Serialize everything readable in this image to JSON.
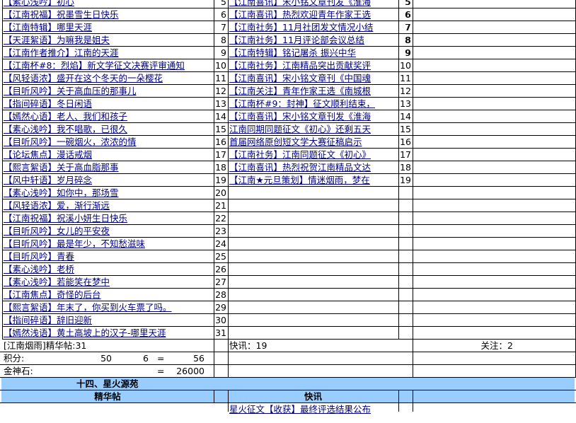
{
  "left_posts": [
    {
      "text": "【素心浅吟】初心",
      "n": "5"
    },
    {
      "text": "【江南祝福】祝墨雪生日快乐",
      "n": "6"
    },
    {
      "text": "【江南特辑】哪里天涯",
      "n": "7"
    },
    {
      "text": "【天涯絮语】为嘛我是姐夫",
      "n": "8"
    },
    {
      "text": "【江南作者推介】江南的天涯",
      "n": "9"
    },
    {
      "text": "【江南杯#8：烈焰】新文学征文决赛评审通知",
      "n": "10"
    },
    {
      "text": "【风轻语浓】盛开在这个冬天的一朵樱花",
      "n": "11"
    },
    {
      "text": "【目听风吟】关于高血压的那事儿",
      "n": "12"
    },
    {
      "text": "【指间碎语】冬日闲语",
      "n": "13"
    },
    {
      "text": "【嫣然心语】老人、我们和孩子",
      "n": "14"
    },
    {
      "text": "【素心浅吟】我不唱歌，已很久",
      "n": "15"
    },
    {
      "text": "【目听风吟】一碗烟火，浓浓的情",
      "n": "16"
    },
    {
      "text": "【论坛焦点】漫话戒烟",
      "n": "17"
    },
    {
      "text": "【熙言絮语】关于高血脂那事",
      "n": "18"
    },
    {
      "text": "【风中轩语】岁月碎念",
      "n": "19"
    },
    {
      "text": "【素心浅吟】如你中，那场雪",
      "n": "20"
    },
    {
      "text": "【风轻语浓】爱，渐行渐远",
      "n": "21"
    },
    {
      "text": "【江南祝福】祝溪小妍生日快乐",
      "n": "22"
    },
    {
      "text": "【目听风吟】女儿的平安夜",
      "n": "23"
    },
    {
      "text": "【目听风吟】最是年少，不知愁滋味",
      "n": "24"
    },
    {
      "text": "【目听风吟】青春",
      "n": "25"
    },
    {
      "text": "【素心浅吟】老桥",
      "n": "26"
    },
    {
      "text": "【素心浅吟】若能笑在梦中",
      "n": "27"
    },
    {
      "text": "【江南焦点】奇怪的后台",
      "n": "28"
    },
    {
      "text": "【熙言絮语】年末了，你买到火车票了吗。",
      "n": "29"
    },
    {
      "text": "【指间碎语】辞旧迎新",
      "n": "30"
    },
    {
      "text": "【嫣然浅语】黄土高坡上的汉子-哪里天涯",
      "n": "31"
    }
  ],
  "mid_posts": [
    {
      "text": "【江南喜讯】宋小铭文章刊发《淮海",
      "n": "5"
    },
    {
      "text": "【江南喜讯】热烈欢迎青年作家王选",
      "n": "6"
    },
    {
      "text": "【江南社务】11月社团发文情况小结",
      "n": "7"
    },
    {
      "text": "【江南社务】11月评论部会议总结",
      "n": "8"
    },
    {
      "text": "【江南特辑】铭记屠杀 振兴中华",
      "n": "9"
    },
    {
      "text": "【江南社务】江南精品突出贡献奖评",
      "n": "10"
    },
    {
      "text": "【江南喜讯】宋小铭文章刊《中国魂",
      "n": "11"
    },
    {
      "text": "【江南关注】青年作家王选《南城根",
      "n": "12"
    },
    {
      "text": "【江南杯#9：封神】征文顺利结束，",
      "n": "13"
    },
    {
      "text": "【江南喜讯】宋小铭文章刊发《淮海",
      "n": "14"
    },
    {
      "text": "江南同期同题征文《初心》还剩五天",
      "n": "15"
    },
    {
      "text": "首届网络原创短文学大赛征稿启示",
      "n": "16"
    },
    {
      "text": "【江南社务】江南同题征文《初心》",
      "n": "17"
    },
    {
      "text": "【江南喜讯】热烈祝贺江南精品文达",
      "n": "18"
    },
    {
      "text": "【江南★元旦策划】情迷烟雨，梦在",
      "n": "19"
    }
  ],
  "right_nums": [
    "5",
    "6",
    "7",
    "8",
    "9"
  ],
  "summary": {
    "forum_count": "[江南烟雨]精华帖:31",
    "kuaixun": "快讯：19",
    "guanzhu": "关注：2",
    "jifen_label": "积分:",
    "jifen_a": "50",
    "jifen_b": "6",
    "eq": "=",
    "jifen_total": "56",
    "jinshen_label": "金神石:",
    "jinshen_total": "26000"
  },
  "section": {
    "title": "十四、星火源苑",
    "col1": "精华帖",
    "col2": "快讯",
    "first_news": "星火征文【收获】最终评选结果公布"
  },
  "colors": {
    "link": "#00007f",
    "header_bg": "#99ccff",
    "header_text": "#ff0000"
  }
}
